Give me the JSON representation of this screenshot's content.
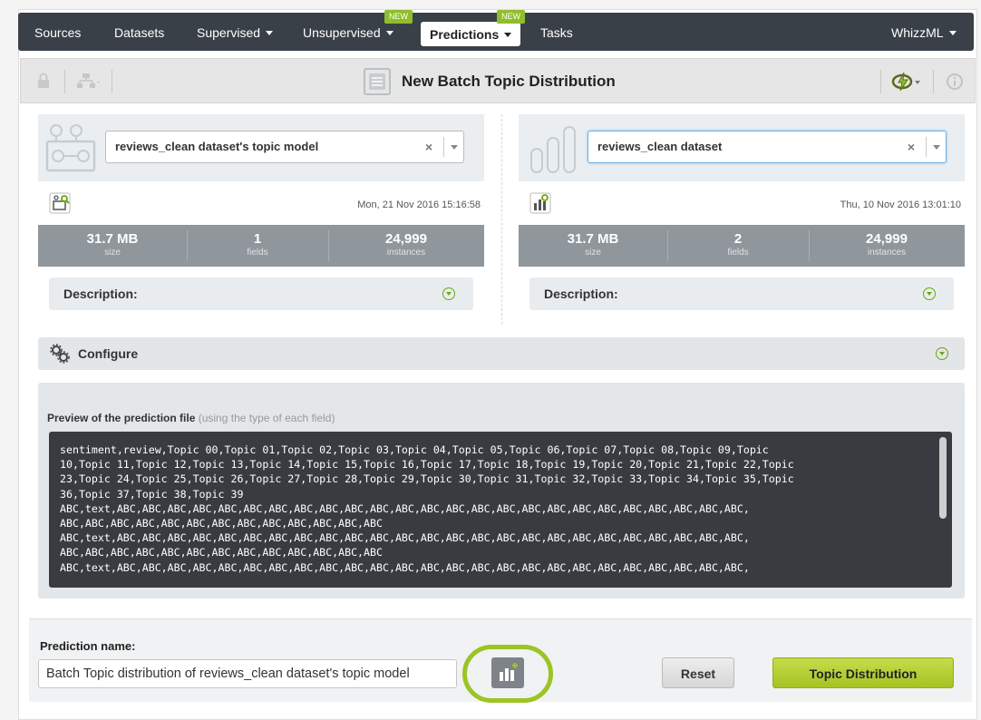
{
  "nav": {
    "items": [
      {
        "label": "Sources"
      },
      {
        "label": "Datasets"
      },
      {
        "label": "Supervised"
      },
      {
        "label": "Unsupervised",
        "badge": "NEW"
      },
      {
        "label": "Predictions",
        "badge": "NEW",
        "active": true
      },
      {
        "label": "Tasks"
      }
    ],
    "right_label": "WhizzML"
  },
  "titlebar": {
    "title": "New Batch Topic Distribution",
    "icons": [
      "lock-icon",
      "tree-icon",
      "batch-icon",
      "lightning-icon",
      "info-icon"
    ]
  },
  "left_panel": {
    "select_value": "reviews_clean dataset's topic model",
    "date": "Mon, 21 Nov 2016 15:16:58",
    "stats": [
      {
        "value": "31.7 MB",
        "label": "size"
      },
      {
        "value": "1",
        "label": "fields"
      },
      {
        "value": "24,999",
        "label": "instances"
      }
    ],
    "description_label": "Description:"
  },
  "right_panel": {
    "select_value": "reviews_clean dataset",
    "date": "Thu, 10 Nov 2016 13:01:10",
    "stats": [
      {
        "value": "31.7 MB",
        "label": "size"
      },
      {
        "value": "2",
        "label": "fields"
      },
      {
        "value": "24,999",
        "label": "instances"
      }
    ],
    "description_label": "Description:"
  },
  "configure": {
    "label": "Configure"
  },
  "preview": {
    "label": "Preview of the prediction file",
    "hint": "(using the type of each field)",
    "text": "sentiment,review,Topic 00,Topic 01,Topic 02,Topic 03,Topic 04,Topic 05,Topic 06,Topic 07,Topic 08,Topic 09,Topic\n10,Topic 11,Topic 12,Topic 13,Topic 14,Topic 15,Topic 16,Topic 17,Topic 18,Topic 19,Topic 20,Topic 21,Topic 22,Topic\n23,Topic 24,Topic 25,Topic 26,Topic 27,Topic 28,Topic 29,Topic 30,Topic 31,Topic 32,Topic 33,Topic 34,Topic 35,Topic\n36,Topic 37,Topic 38,Topic 39\nABC,text,ABC,ABC,ABC,ABC,ABC,ABC,ABC,ABC,ABC,ABC,ABC,ABC,ABC,ABC,ABC,ABC,ABC,ABC,ABC,ABC,ABC,ABC,ABC,ABC,ABC,\nABC,ABC,ABC,ABC,ABC,ABC,ABC,ABC,ABC,ABC,ABC,ABC,ABC\nABC,text,ABC,ABC,ABC,ABC,ABC,ABC,ABC,ABC,ABC,ABC,ABC,ABC,ABC,ABC,ABC,ABC,ABC,ABC,ABC,ABC,ABC,ABC,ABC,ABC,ABC,\nABC,ABC,ABC,ABC,ABC,ABC,ABC,ABC,ABC,ABC,ABC,ABC,ABC\nABC,text,ABC,ABC,ABC,ABC,ABC,ABC,ABC,ABC,ABC,ABC,ABC,ABC,ABC,ABC,ABC,ABC,ABC,ABC,ABC,ABC,ABC,ABC,ABC,ABC,ABC,"
  },
  "form": {
    "name_label": "Prediction name:",
    "name_value": "Batch Topic distribution of reviews_clean dataset's topic model",
    "reset_label": "Reset",
    "submit_label": "Topic Distribution"
  },
  "colors": {
    "navbar": "#3a4047",
    "accent_green": "#9cc425",
    "stats_bg": "#8f969c"
  }
}
